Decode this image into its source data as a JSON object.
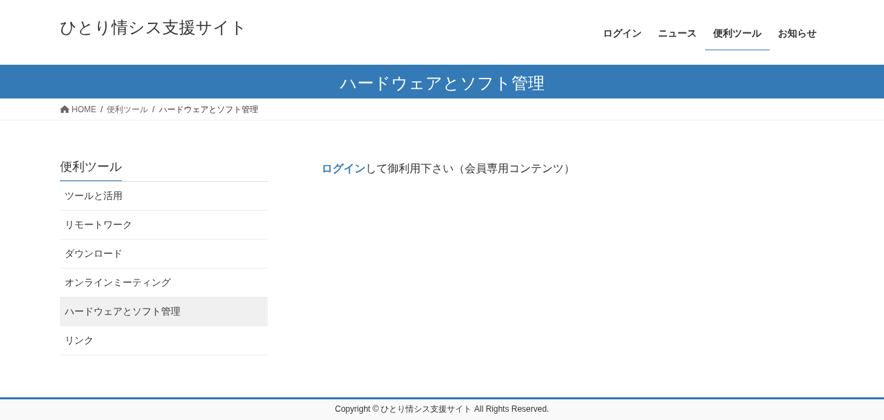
{
  "site_title": "ひとり情シス支援サイト",
  "nav": [
    {
      "label": "ログイン",
      "selected": false
    },
    {
      "label": "ニュース",
      "selected": false
    },
    {
      "label": "便利ツール",
      "selected": true
    },
    {
      "label": "お知らせ",
      "selected": false
    }
  ],
  "page_title": "ハードウェアとソフト管理",
  "breadcrumb": [
    {
      "label": "HOME",
      "kind": "home"
    },
    {
      "label": "便利ツール",
      "kind": "link"
    },
    {
      "label": "ハードウェアとソフト管理",
      "kind": "current"
    }
  ],
  "breadcrumb_separator": "/",
  "sidebar": {
    "title": "便利ツール",
    "items": [
      {
        "label": "ツールと活用",
        "selected": false
      },
      {
        "label": "リモートワーク",
        "selected": false
      },
      {
        "label": "ダウンロード",
        "selected": false
      },
      {
        "label": "オンラインミーティング",
        "selected": false
      },
      {
        "label": "ハードウェアとソフト管理",
        "selected": true
      },
      {
        "label": "リンク",
        "selected": false
      }
    ]
  },
  "message": {
    "link": "ログイン",
    "text": "して御利用下さい（会員専用コンテンツ）"
  },
  "footer": "Copyright © ひとり情シス支援サイト All Rights Reserved."
}
